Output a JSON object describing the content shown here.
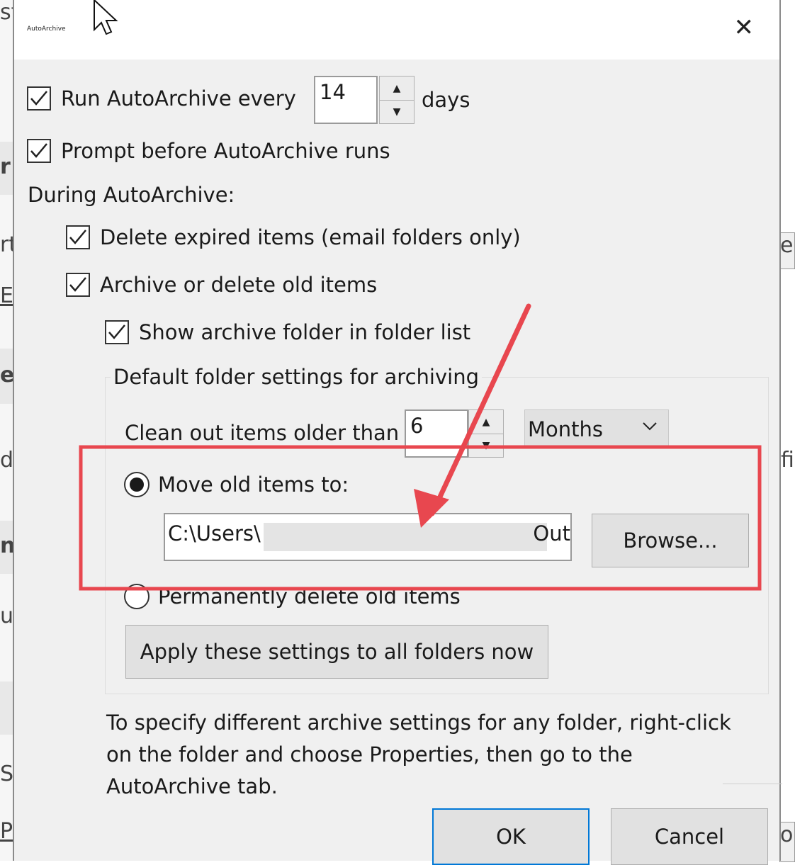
{
  "background": {
    "left_texts": [
      "st",
      "r",
      "rt",
      "E",
      "e",
      "du",
      "n",
      "u",
      "S",
      "P"
    ],
    "right_texts": [
      "e.",
      "fil",
      "o"
    ]
  },
  "dialog": {
    "title": "AutoArchive",
    "close_glyph": "✕",
    "run_every": {
      "checked": true,
      "label": "Run AutoArchive every",
      "value": "14",
      "unit": "days"
    },
    "prompt_before": {
      "checked": true,
      "label": "Prompt before AutoArchive runs"
    },
    "during_label": "During AutoArchive:",
    "delete_expired": {
      "checked": true,
      "label": "Delete expired items (email folders only)"
    },
    "archive_old": {
      "checked": true,
      "label": "Archive or delete old items"
    },
    "show_folder": {
      "checked": true,
      "label": "Show archive folder in folder list"
    },
    "group": {
      "title": "Default folder settings for archiving",
      "clean_label": "Clean out items older than",
      "clean_value": "6",
      "clean_unit": "Months",
      "move_option": {
        "selected": true,
        "label": "Move old items to:"
      },
      "path_start": "C:\\Users\\",
      "path_end": "Out",
      "browse_label": "Browse...",
      "delete_option": {
        "selected": false,
        "label": "Permanently delete old items"
      },
      "apply_label": "Apply these settings to all folders now"
    },
    "note": "To specify different archive settings for any folder, right-click on the folder and choose Properties, then go to the AutoArchive tab.",
    "ok_label": "OK",
    "cancel_label": "Cancel"
  },
  "annotation_color": "#e8474f"
}
